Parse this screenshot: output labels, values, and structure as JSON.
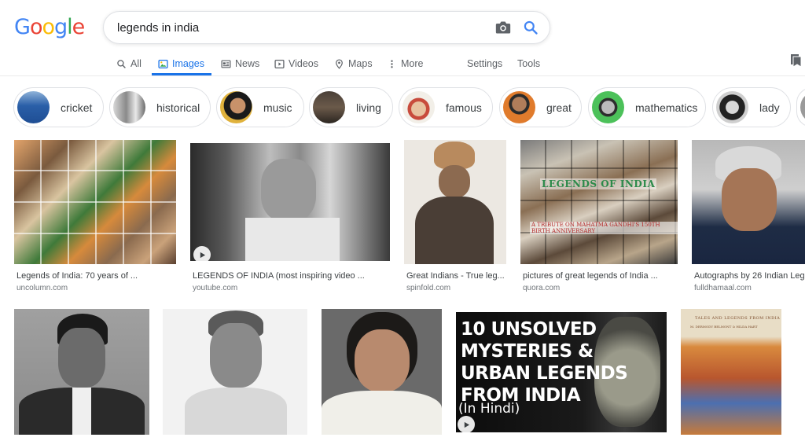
{
  "logo": {
    "letters": [
      "G",
      "o",
      "o",
      "g",
      "l",
      "e"
    ],
    "colors": [
      "#4285f4",
      "#ea4335",
      "#fbbc05",
      "#4285f4",
      "#34a853",
      "#ea4335"
    ]
  },
  "search": {
    "query": "legends in india"
  },
  "tabs": [
    {
      "label": "All",
      "icon": "search-icon"
    },
    {
      "label": "Images",
      "icon": "image-icon",
      "active": true
    },
    {
      "label": "News",
      "icon": "newspaper-icon"
    },
    {
      "label": "Videos",
      "icon": "play-icon"
    },
    {
      "label": "Maps",
      "icon": "map-pin-icon"
    },
    {
      "label": "More",
      "icon": "more-vert-icon"
    },
    {
      "label": "Settings"
    },
    {
      "label": "Tools"
    }
  ],
  "chips": [
    "cricket",
    "historical",
    "music",
    "living",
    "famous",
    "great",
    "mathematics",
    "lady"
  ],
  "results_row1": [
    {
      "caption": "Legends of India: 70 years of ...",
      "source": "uncolumn.com"
    },
    {
      "caption": "LEGENDS OF INDIA (most inspiring video ...",
      "source": "youtube.com"
    },
    {
      "caption": "Great Indians - True leg...",
      "source": "spinfold.com"
    },
    {
      "caption": "pictures of great legends of India ...",
      "source": "quora.com"
    },
    {
      "caption": "Autographs by 26 Indian Leg",
      "source": "fulldhamaal.com"
    }
  ],
  "overlays": {
    "legends_title": "LEGENDS OF INDIA",
    "legends_sub": "A TRIBUTE ON MAHATMA GANDHI'S 150TH BIRTH ANNIVERSARY",
    "mystery_lines": [
      "10 UNSOLVED",
      "MYSTERIES &",
      "URBAN LEGENDS",
      "FROM INDIA"
    ],
    "mystery_sub": "(In Hindi)",
    "book_title": "TALES AND LEGENDS FROM INDIA",
    "book_author": "M. DERMODY BELMONT & HILDA HART"
  }
}
